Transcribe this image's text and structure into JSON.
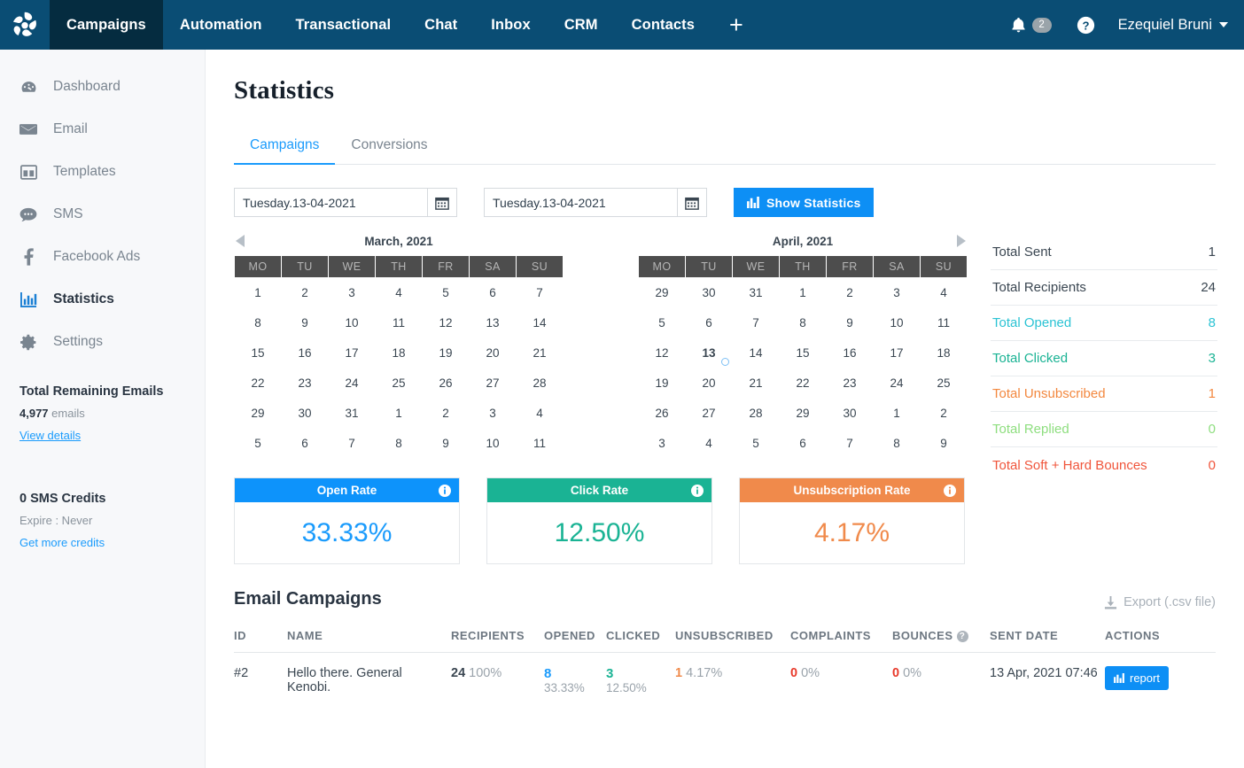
{
  "topnav": {
    "logo_name": "pinwheel-logo",
    "items": [
      {
        "label": "Campaigns",
        "active": true
      },
      {
        "label": "Automation",
        "active": false
      },
      {
        "label": "Transactional",
        "active": false
      },
      {
        "label": "Chat",
        "active": false
      },
      {
        "label": "Inbox",
        "active": false
      },
      {
        "label": "CRM",
        "active": false
      },
      {
        "label": "Contacts",
        "active": false
      }
    ],
    "add_label": "+",
    "notifications_count": "2",
    "help_label": "?",
    "user_name": "Ezequiel Bruni"
  },
  "sidebar": {
    "items": [
      {
        "label": "Dashboard",
        "icon": "dashboard-icon",
        "active": false
      },
      {
        "label": "Email",
        "icon": "envelope-icon",
        "active": false
      },
      {
        "label": "Templates",
        "icon": "template-icon",
        "active": false
      },
      {
        "label": "SMS",
        "icon": "chat-bubble-icon",
        "active": false
      },
      {
        "label": "Facebook Ads",
        "icon": "facebook-icon",
        "active": false
      },
      {
        "label": "Statistics",
        "icon": "bar-chart-icon",
        "active": true
      },
      {
        "label": "Settings",
        "icon": "gear-icon",
        "active": false
      }
    ],
    "emails_title": "Total Remaining Emails",
    "emails_count": "4,977",
    "emails_unit": "emails",
    "emails_link": "View details",
    "sms_title": "0 SMS Credits",
    "sms_expire": "Expire : Never",
    "sms_link": "Get more credits"
  },
  "main": {
    "page_title": "Statistics",
    "tabs": [
      {
        "label": "Campaigns",
        "active": true
      },
      {
        "label": "Conversions",
        "active": false
      }
    ],
    "date_from": "Tuesday.13-04-2021",
    "date_to": "Tuesday.13-04-2021",
    "show_statistics_label": "Show Statistics"
  },
  "calendars": [
    {
      "title": "March, 2021",
      "prev_arrow": true,
      "next_arrow": false,
      "weekdays": [
        "MO",
        "TU",
        "WE",
        "TH",
        "FR",
        "SA",
        "SU"
      ],
      "weeks": [
        [
          {
            "d": "1",
            "s": "in"
          },
          {
            "d": "2",
            "s": "in"
          },
          {
            "d": "3",
            "s": "in"
          },
          {
            "d": "4",
            "s": "in"
          },
          {
            "d": "5",
            "s": "in"
          },
          {
            "d": "6",
            "s": "in"
          },
          {
            "d": "7",
            "s": "in"
          }
        ],
        [
          {
            "d": "8",
            "s": "in"
          },
          {
            "d": "9",
            "s": "in"
          },
          {
            "d": "10",
            "s": "in"
          },
          {
            "d": "11",
            "s": "in"
          },
          {
            "d": "12",
            "s": "in"
          },
          {
            "d": "13",
            "s": "in"
          },
          {
            "d": "14",
            "s": "in"
          }
        ],
        [
          {
            "d": "15",
            "s": "in"
          },
          {
            "d": "16",
            "s": "in"
          },
          {
            "d": "17",
            "s": "in"
          },
          {
            "d": "18",
            "s": "in"
          },
          {
            "d": "19",
            "s": "in"
          },
          {
            "d": "20",
            "s": "in"
          },
          {
            "d": "21",
            "s": "in"
          }
        ],
        [
          {
            "d": "22",
            "s": "in"
          },
          {
            "d": "23",
            "s": "in"
          },
          {
            "d": "24",
            "s": "in"
          },
          {
            "d": "25",
            "s": "in"
          },
          {
            "d": "26",
            "s": "in"
          },
          {
            "d": "27",
            "s": "in"
          },
          {
            "d": "28",
            "s": "in"
          }
        ],
        [
          {
            "d": "29",
            "s": "in"
          },
          {
            "d": "30",
            "s": "in"
          },
          {
            "d": "31",
            "s": "in"
          },
          {
            "d": "1",
            "s": "inactive"
          },
          {
            "d": "2",
            "s": "inactive"
          },
          {
            "d": "3",
            "s": "inactive"
          },
          {
            "d": "4",
            "s": "inactive"
          }
        ],
        [
          {
            "d": "5",
            "s": "inactive"
          },
          {
            "d": "6",
            "s": "inactive"
          },
          {
            "d": "7",
            "s": "inactive"
          },
          {
            "d": "8",
            "s": "inactive"
          },
          {
            "d": "9",
            "s": "inactive"
          },
          {
            "d": "10",
            "s": "inactive"
          },
          {
            "d": "11",
            "s": "inactive"
          }
        ]
      ]
    },
    {
      "title": "April, 2021",
      "prev_arrow": false,
      "next_arrow": true,
      "weekdays": [
        "MO",
        "TU",
        "WE",
        "TH",
        "FR",
        "SA",
        "SU"
      ],
      "weeks": [
        [
          {
            "d": "29",
            "s": "inactive"
          },
          {
            "d": "30",
            "s": "inactive"
          },
          {
            "d": "31",
            "s": "inactive"
          },
          {
            "d": "1",
            "s": "in"
          },
          {
            "d": "2",
            "s": "in"
          },
          {
            "d": "3",
            "s": "in"
          },
          {
            "d": "4",
            "s": "in"
          }
        ],
        [
          {
            "d": "5",
            "s": "in"
          },
          {
            "d": "6",
            "s": "in"
          },
          {
            "d": "7",
            "s": "in"
          },
          {
            "d": "8",
            "s": "in"
          },
          {
            "d": "9",
            "s": "in"
          },
          {
            "d": "10",
            "s": "in"
          },
          {
            "d": "11",
            "s": "in"
          }
        ],
        [
          {
            "d": "12",
            "s": "in"
          },
          {
            "d": "13",
            "s": "sel"
          },
          {
            "d": "14",
            "s": "in dim"
          },
          {
            "d": "15",
            "s": "in dim"
          },
          {
            "d": "16",
            "s": "in dim"
          },
          {
            "d": "17",
            "s": "in dim"
          },
          {
            "d": "18",
            "s": "in dim"
          }
        ],
        [
          {
            "d": "19",
            "s": "in dim"
          },
          {
            "d": "20",
            "s": "in dim"
          },
          {
            "d": "21",
            "s": "in dim"
          },
          {
            "d": "22",
            "s": "in dim"
          },
          {
            "d": "23",
            "s": "in dim"
          },
          {
            "d": "24",
            "s": "in dim"
          },
          {
            "d": "25",
            "s": "in dim"
          }
        ],
        [
          {
            "d": "26",
            "s": "in dim"
          },
          {
            "d": "27",
            "s": "in dim"
          },
          {
            "d": "28",
            "s": "in dim"
          },
          {
            "d": "29",
            "s": "in dim"
          },
          {
            "d": "30",
            "s": "in dim"
          },
          {
            "d": "1",
            "s": "inactive"
          },
          {
            "d": "2",
            "s": "inactive"
          }
        ],
        [
          {
            "d": "3",
            "s": "inactive"
          },
          {
            "d": "4",
            "s": "inactive"
          },
          {
            "d": "5",
            "s": "inactive"
          },
          {
            "d": "6",
            "s": "inactive"
          },
          {
            "d": "7",
            "s": "inactive"
          },
          {
            "d": "8",
            "s": "inactive"
          },
          {
            "d": "9",
            "s": "inactive"
          }
        ]
      ]
    }
  ],
  "totals": [
    {
      "label": "Total Sent",
      "value": "1",
      "color": "#3a4651"
    },
    {
      "label": "Total Recipients",
      "value": "24",
      "color": "#3a4651"
    },
    {
      "label": "Total Opened",
      "value": "8",
      "color": "#2bc3d4"
    },
    {
      "label": "Total Clicked",
      "value": "3",
      "color": "#1ab394"
    },
    {
      "label": "Total Unsubscribed",
      "value": "1",
      "color": "#f3883f"
    },
    {
      "label": "Total Replied",
      "value": "0",
      "color": "#8ede7f"
    },
    {
      "label": "Total Soft + Hard Bounces",
      "value": "0",
      "color": "#f0553b"
    }
  ],
  "rates": [
    {
      "title": "Open Rate",
      "value": "33.33%",
      "color": "#0d93fb",
      "text_color": "#1a9bfc"
    },
    {
      "title": "Click Rate",
      "value": "12.50%",
      "color": "#1ab394",
      "text_color": "#1ab394"
    },
    {
      "title": "Unsubscription Rate",
      "value": "4.17%",
      "color": "#f08a4b",
      "text_color": "#f08a4b"
    }
  ],
  "campaigns": {
    "title": "Email Campaigns",
    "export_label": "Export (.csv file)",
    "columns": [
      "ID",
      "NAME",
      "RECIPIENTS",
      "OPENED",
      "CLICKED",
      "UNSUBSCRIBED",
      "COMPLAINTS",
      "BOUNCES",
      "SENT DATE",
      "ACTIONS"
    ],
    "rows": [
      {
        "id": "#2",
        "name": "Hello there. General Kenobi.",
        "recipients_value": "24",
        "recipients_pct": "100%",
        "opened_value": "8",
        "opened_pct": "33.33%",
        "clicked_value": "3",
        "clicked_pct": "12.50%",
        "unsubscribed_value": "1",
        "unsubscribed_pct": "4.17%",
        "complaints_value": "0",
        "complaints_pct": "0%",
        "bounces_value": "0",
        "bounces_pct": "0%",
        "sent_date": "13 Apr, 2021 07:46",
        "action_label": "report"
      }
    ]
  }
}
